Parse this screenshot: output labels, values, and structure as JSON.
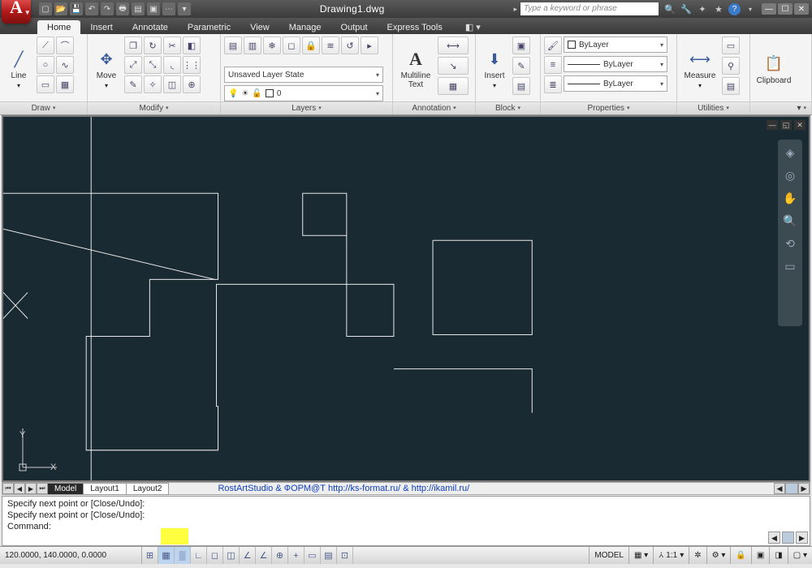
{
  "title": "Drawing1.dwg",
  "search_placeholder": "Type a keyword or phrase",
  "menu": {
    "tabs": [
      "Home",
      "Insert",
      "Annotate",
      "Parametric",
      "View",
      "Manage",
      "Output",
      "Express Tools"
    ],
    "active": 0
  },
  "ribbon": {
    "draw": {
      "title": "Draw",
      "main": "Line"
    },
    "modify": {
      "title": "Modify",
      "main": "Move"
    },
    "layers": {
      "title": "Layers",
      "state": "Unsaved Layer State",
      "current": "0"
    },
    "annotation": {
      "title": "Annotation",
      "main": "Multiline\nText"
    },
    "block": {
      "title": "Block",
      "main": "Insert"
    },
    "properties": {
      "title": "Properties",
      "color": "ByLayer",
      "ltype": "ByLayer",
      "lweight": "ByLayer"
    },
    "utilities": {
      "title": "Utilities",
      "main": "Measure"
    },
    "clipboard": {
      "title": "Clipboard",
      "main": "Clipboard"
    }
  },
  "layout": {
    "tabs": [
      "Model",
      "Layout1",
      "Layout2"
    ],
    "active": 0,
    "link": "RostArtStudio & ФОРМ@Т http://ks-format.ru/ & http://ikamil.ru/"
  },
  "cmd": {
    "lines": [
      "Specify next point or [Close/Undo]:",
      "Specify next point or [Close/Undo]:",
      "",
      "Command:"
    ]
  },
  "status": {
    "coords": "120.0000, 140.0000, 0.0000",
    "space": "MODEL",
    "scale": "1:1"
  }
}
